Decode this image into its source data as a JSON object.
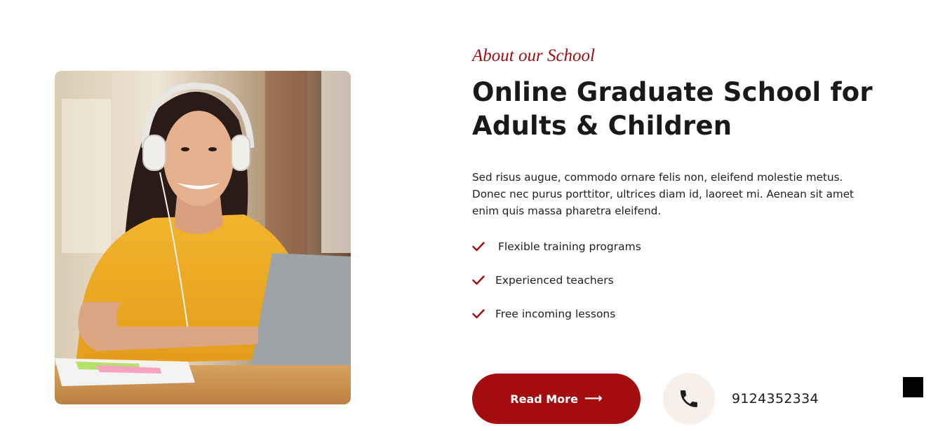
{
  "about": {
    "eyebrow": "About our School",
    "title": "Online Graduate School for Adults & Children",
    "description": "Sed risus augue, commodo ornare felis non, eleifend molestie metus. Donec nec purus porttitor, ultrices diam id, laoreet mi. Aenean sit amet enim quis massa pharetra eleifend.",
    "features": [
      {
        "label": "Flexible training programs",
        "icon": "check-icon"
      },
      {
        "label": "Experienced teachers",
        "icon": "check-icon"
      },
      {
        "label": "Free incoming lessons",
        "icon": "check-icon"
      }
    ],
    "read_more_label": "Read More",
    "read_more_icon": "arrow-right-icon",
    "phone_icon": "phone-icon",
    "phone_number": "9124352334"
  },
  "colors": {
    "accent": "#a30d0f",
    "eyebrow": "#9b0f12",
    "heading": "#19191c",
    "phone_bg": "#f6efea"
  },
  "image": {
    "subject": "smiling student with headphones at laptop"
  }
}
